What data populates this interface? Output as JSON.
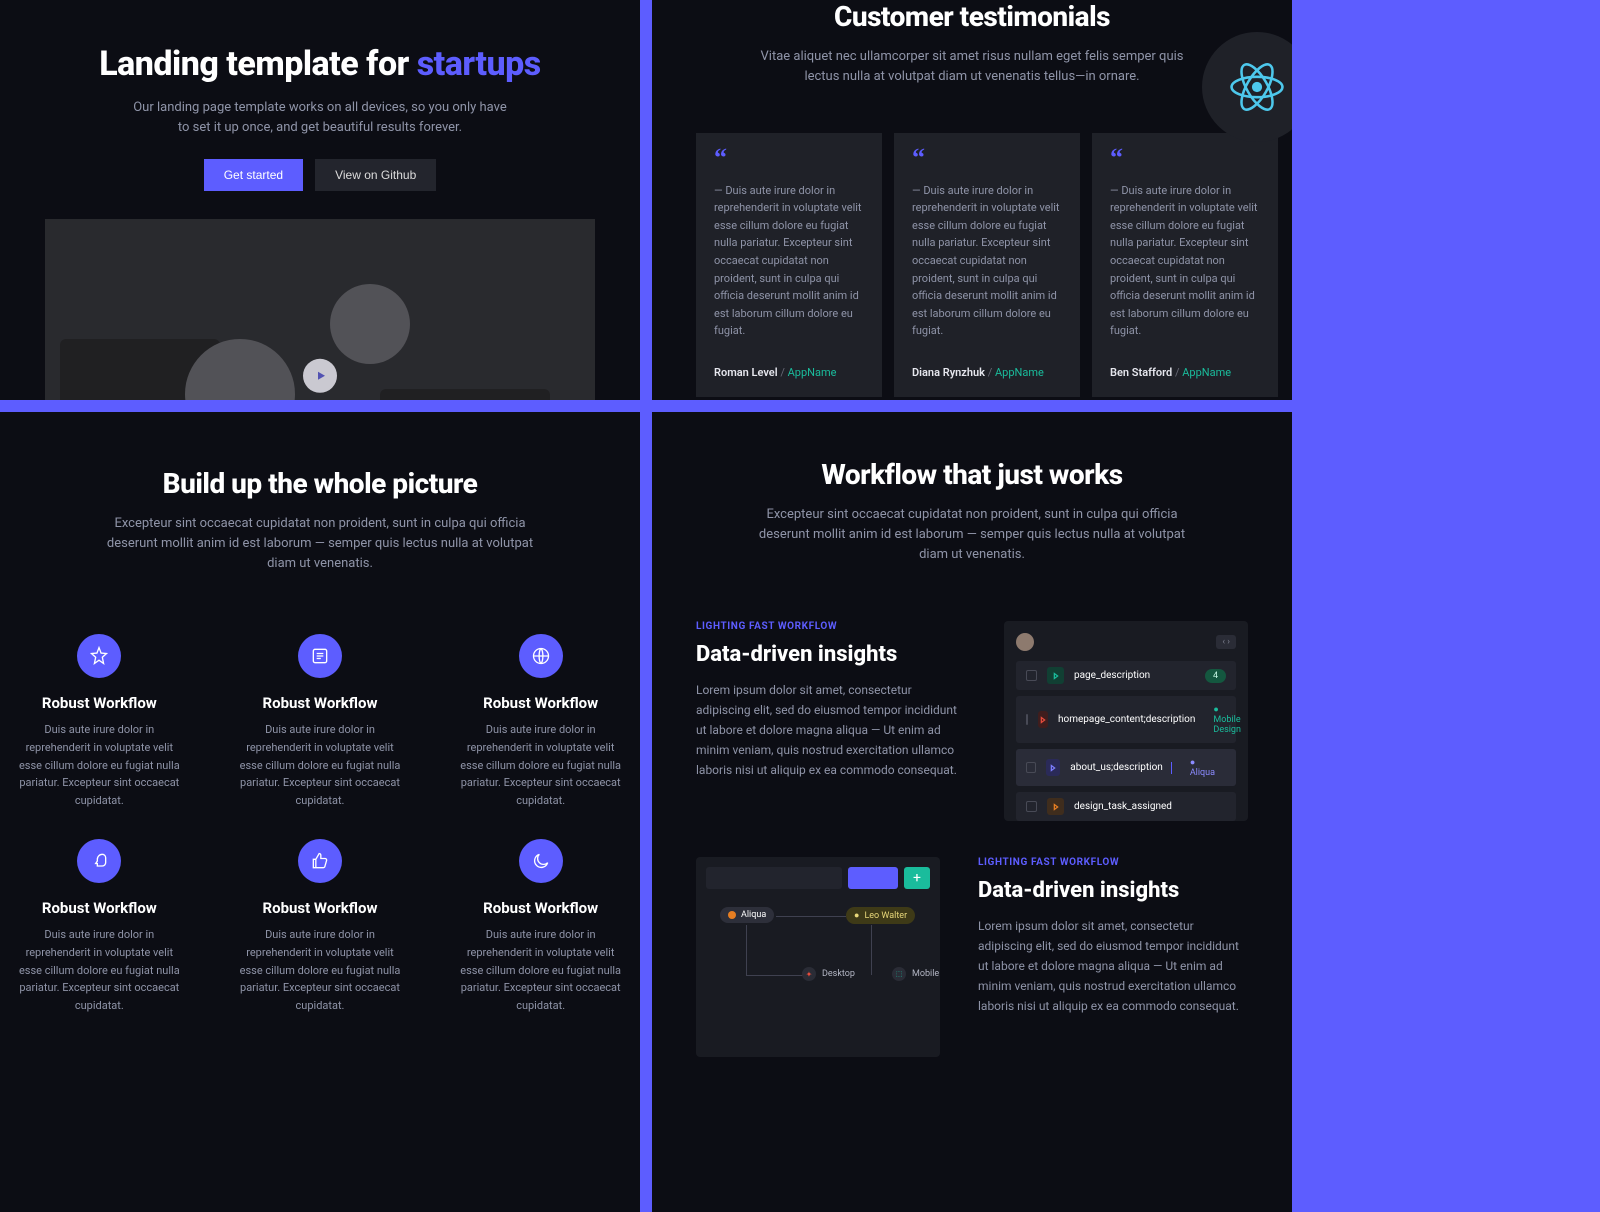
{
  "hero": {
    "title_a": "Landing template for ",
    "title_b": "startups",
    "sub": "Our landing page template works on all devices, so you only have to set it up once, and get beautiful results forever.",
    "btn_primary": "Get started",
    "btn_secondary": "View on Github"
  },
  "testimonials": {
    "title": "Customer testimonials",
    "sub": "Vitae aliquet nec ullamcorper sit amet risus nullam eget felis semper quis lectus nulla at volutpat diam ut venenatis tellus—in ornare.",
    "cards": [
      {
        "text": "— Duis aute irure dolor in reprehenderit in voluptate velit esse cillum dolore eu fugiat nulla pariatur. Excepteur sint occaecat cupidatat non proident, sunt in culpa qui officia deserunt mollit anim id est laborum cillum dolore eu fugiat.",
        "name": "Roman Level",
        "app": "AppName"
      },
      {
        "text": "— Duis aute irure dolor in reprehenderit in voluptate velit esse cillum dolore eu fugiat nulla pariatur. Excepteur sint occaecat cupidatat non proident, sunt in culpa qui officia deserunt mollit anim id est laborum cillum dolore eu fugiat.",
        "name": "Diana Rynzhuk",
        "app": "AppName"
      },
      {
        "text": "— Duis aute irure dolor in reprehenderit in voluptate velit esse cillum dolore eu fugiat nulla pariatur. Excepteur sint occaecat cupidatat non proident, sunt in culpa qui officia deserunt mollit anim id est laborum cillum dolore eu fugiat.",
        "name": "Ben Stafford",
        "app": "AppName"
      }
    ]
  },
  "features": {
    "title": "Build up the whole picture",
    "sub": "Excepteur sint occaecat cupidatat non proident, sunt in culpa qui officia deserunt mollit anim id est laborum — semper quis lectus nulla at volutpat diam ut venenatis.",
    "item_title": "Robust Workflow",
    "item_body": "Duis aute irure dolor in reprehenderit in voluptate velit esse cillum dolore eu fugiat nulla pariatur. Excepteur sint occaecat cupidatat."
  },
  "workflow": {
    "title": "Workflow that just works",
    "sub": "Excepteur sint occaecat cupidatat non proident, sunt in culpa qui officia deserunt mollit anim id est laborum — semper quis lectus nulla at volutpat diam ut venenatis.",
    "kicker": "LIGHTING FAST WORKFLOW",
    "block_title": "Data-driven insights",
    "block_body": "Lorem ipsum dolor sit amet, consectetur adipiscing elit, sed do eiusmod tempor incididunt ut labore et dolore magna aliqua — Ut enim ad minim veniam, quis nostrud exercitation ullamco laboris nisi ut aliquip ex ea commodo consequat.",
    "mock1": {
      "rows": [
        {
          "label": "page_description",
          "badge": "4",
          "tag_color": "#1abc9c"
        },
        {
          "label": "homepage_content;description",
          "pill": "Mobile Design",
          "pill_color": "#1abc9c",
          "tag_color": "#e74c3c"
        },
        {
          "label": "about_us;description",
          "pill": "Aliqua",
          "pill_color": "#5d5dff",
          "tag_color": "#5d5dff"
        },
        {
          "label": "design_task_assigned",
          "tag_color": "#e67e22"
        }
      ]
    },
    "mock2": {
      "chip": "Aliqua",
      "person": "Leo Walter",
      "node_a": "Desktop",
      "node_b": "Mobile"
    }
  }
}
